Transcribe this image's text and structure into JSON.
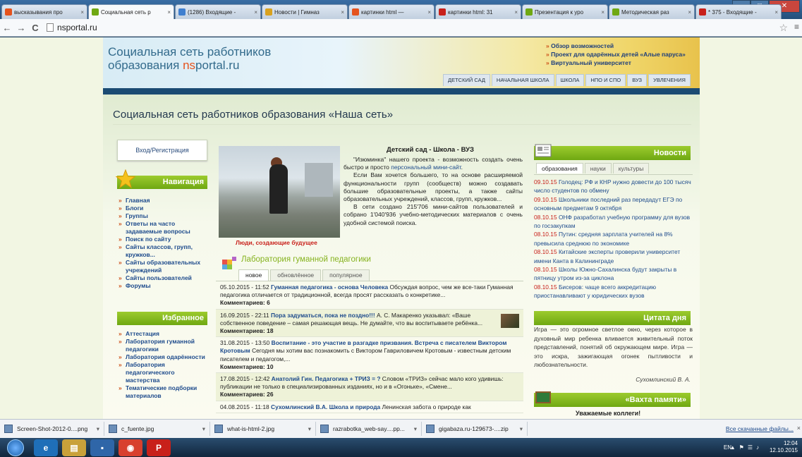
{
  "browser": {
    "tabs": [
      {
        "label": "высказывания про",
        "color": "#e5531d"
      },
      {
        "label": "Социальная сеть р",
        "color": "#6fa812",
        "active": true
      },
      {
        "label": "(1286) Входящие -",
        "color": "#3f7fcf"
      },
      {
        "label": "Новости | Гимназ",
        "color": "#d9a21f"
      },
      {
        "label": "картинки html —",
        "color": "#e5531d"
      },
      {
        "label": "картинки html: 31",
        "color": "#c8201a"
      },
      {
        "label": "Презентация к уро",
        "color": "#6fa812"
      },
      {
        "label": "Методическая раз",
        "color": "#6fa812"
      },
      {
        "label": "* 375 - Входящие -",
        "color": "#c8201a"
      }
    ],
    "tab_close": "×",
    "url": "nsportal.ru",
    "back": "←",
    "forward": "→",
    "reload": "C",
    "star": "☆",
    "menu": "≡",
    "win_min": "–",
    "win_max": "□",
    "win_close": "✕"
  },
  "header": {
    "logo_line1": "Социальная сеть работников",
    "logo_line2_prefix": "образования ",
    "logo_line2_ns": "ns",
    "logo_line2_suffix": "portal.ru",
    "top_links": [
      "Обзор возможностей",
      "Проект для одарённых детей «Алые паруса»",
      "Виртуальный университет"
    ],
    "nav_tabs": [
      "ДЕТСКИЙ САД",
      "НАЧАЛЬНАЯ ШКОЛА",
      "ШКОЛА",
      "НПО И СПО",
      "ВУЗ",
      "УВЛЕЧЕНИЯ"
    ]
  },
  "page_title": "Социальная сеть работников образования «Наша сеть»",
  "left": {
    "login": "Вход/Регистрация",
    "nav_title": "Навигация",
    "nav_links": [
      "Главная",
      "Блоги",
      "Группы",
      "Ответы на часто задаваемые вопросы",
      "Поиск по сайту",
      "Сайты классов, групп, кружков...",
      "Сайты образовательных учреждений",
      "Сайты пользователей",
      "Форумы"
    ],
    "fav_title": "Избранное",
    "fav_links": [
      "Аттестация",
      "Лаборатория гуманной педагогики",
      "Лаборатория одарённости",
      "Лаборатория педагогического мастерства",
      "Тематические подборки материалов"
    ]
  },
  "center": {
    "caption": "Люди, создающие будущее",
    "intro_title": "Детский сад - Школа - ВУЗ",
    "intro_p1a": "\"Изюминка\" нашего проекта - возможность создать очень быстро и просто ",
    "intro_p1link": "персональный мини-сайт",
    "intro_p2": "Если Вам хочется большего, то на основе расширяемой функциональности групп (сообществ) можно создавать большие образовательные проекты, а также сайты образовательных учреждений, классов, групп, кружков...",
    "intro_p3": "В сети создано 215'706 мини-сайтов пользователей и собрано 1'040'936 учебно-методических материалов с очень удобной системой поиска.",
    "lab_title": "Лаборатория гуманной педагогики",
    "lab_tabs": [
      "новое",
      "обновлённое",
      "популярное"
    ],
    "items": [
      {
        "date": "05.10.2015 - 11:52",
        "title": "Гуманная педагогика - основа Человека",
        "text": "Обсуждая вопрос, чем же все-таки Гуманная педагогика отличается от традиционной, всегда просят рассказать о конкретике...",
        "comments": "Комментариев: 6"
      },
      {
        "date": "16.09.2015 - 22:11",
        "title": "Пора задуматься, пока не поздно!!!",
        "text": "А. С. Макаренко указывал: «Ваше собственное поведение – самая решающая вещь. Не думайте, что вы воспитываете ребёнка...",
        "comments": "Комментариев: 18"
      },
      {
        "date": "31.08.2015 - 13:50",
        "title": "Воспитание - это участие в разгадке призвания. Встреча с писателем Виктором Кротовым",
        "text": "Сегодня мы хотим вас познакомить с Виктором Гавриловичем Кротовым - известным детским писателем и педагогом,...",
        "comments": "Комментариев: 10"
      },
      {
        "date": "17.08.2015 - 12:42",
        "title": "Анатолий Гин. Педагогика + ТРИЗ = ?",
        "text": "Словом «ТРИЗ» сейчас мало кого удивишь: публикации не только в специализированных изданиях, но и в «Огоньке», «Смене...",
        "comments": "Комментариев: 26"
      },
      {
        "date": "04.08.2015 - 11:18",
        "title": "Сухомлинский В.А. Школа и природа",
        "text": "Ленинская забота о природе как",
        "comments": ""
      }
    ]
  },
  "right": {
    "news_title": "Новости",
    "news_tabs": [
      "образования",
      "науки",
      "культуры"
    ],
    "news": [
      {
        "date": "09.10.15",
        "text": "Голодец: РФ и КНР нужно довести до 100 тысяч число студентов по обмену"
      },
      {
        "date": "09.10.15",
        "text": "Школьники последний раз передадут ЕГЭ по основным предметам 9 октября"
      },
      {
        "date": "08.10.15",
        "text": "ОНФ разработал учебную программу для вузов по госзакупкам"
      },
      {
        "date": "08.10.15",
        "text": "Путин: средняя зарплата учителей на 8% превысила среднюю по экономике"
      },
      {
        "date": "08.10.15",
        "text": "Китайские эксперты проверили университет имени Канта в Калининграде"
      },
      {
        "date": "08.10.15",
        "text": "Школы Южно-Сахалинска будут закрыты в пятницу утром из-за циклона"
      },
      {
        "date": "08.10.15",
        "text": "Бисеров: чаще всего аккредитацию приостанавливают у юридических вузов"
      }
    ],
    "quote_title": "Цитата дня",
    "quote": "Игра — это огромное светлое окно, через которое в духовный мир ребенка вливается живительный поток представлений, понятий об окружающем мире. Игра — это искра, зажигающая огонек пытливости и любознательности.",
    "quote_author": "Сухомлинский В. А.",
    "memory_title": "«Вахта памяти»",
    "memory_text": "Уважаемые коллеги!"
  },
  "downloads": {
    "items": [
      "Screen-Shot-2012-0....png",
      "c_fuente.jpg",
      "what-is-html-2.jpg",
      "razrabotka_web-say....pp...",
      "gigabaza.ru-129673-....zip"
    ],
    "arrow": "▾",
    "show_all": "Все скачанные файлы...",
    "close": "×"
  },
  "taskbar": {
    "lang": "EN",
    "time": "12:04",
    "date": "12.10.2015",
    "icons": [
      "e",
      "▤",
      "▪",
      "◉",
      "P"
    ]
  }
}
